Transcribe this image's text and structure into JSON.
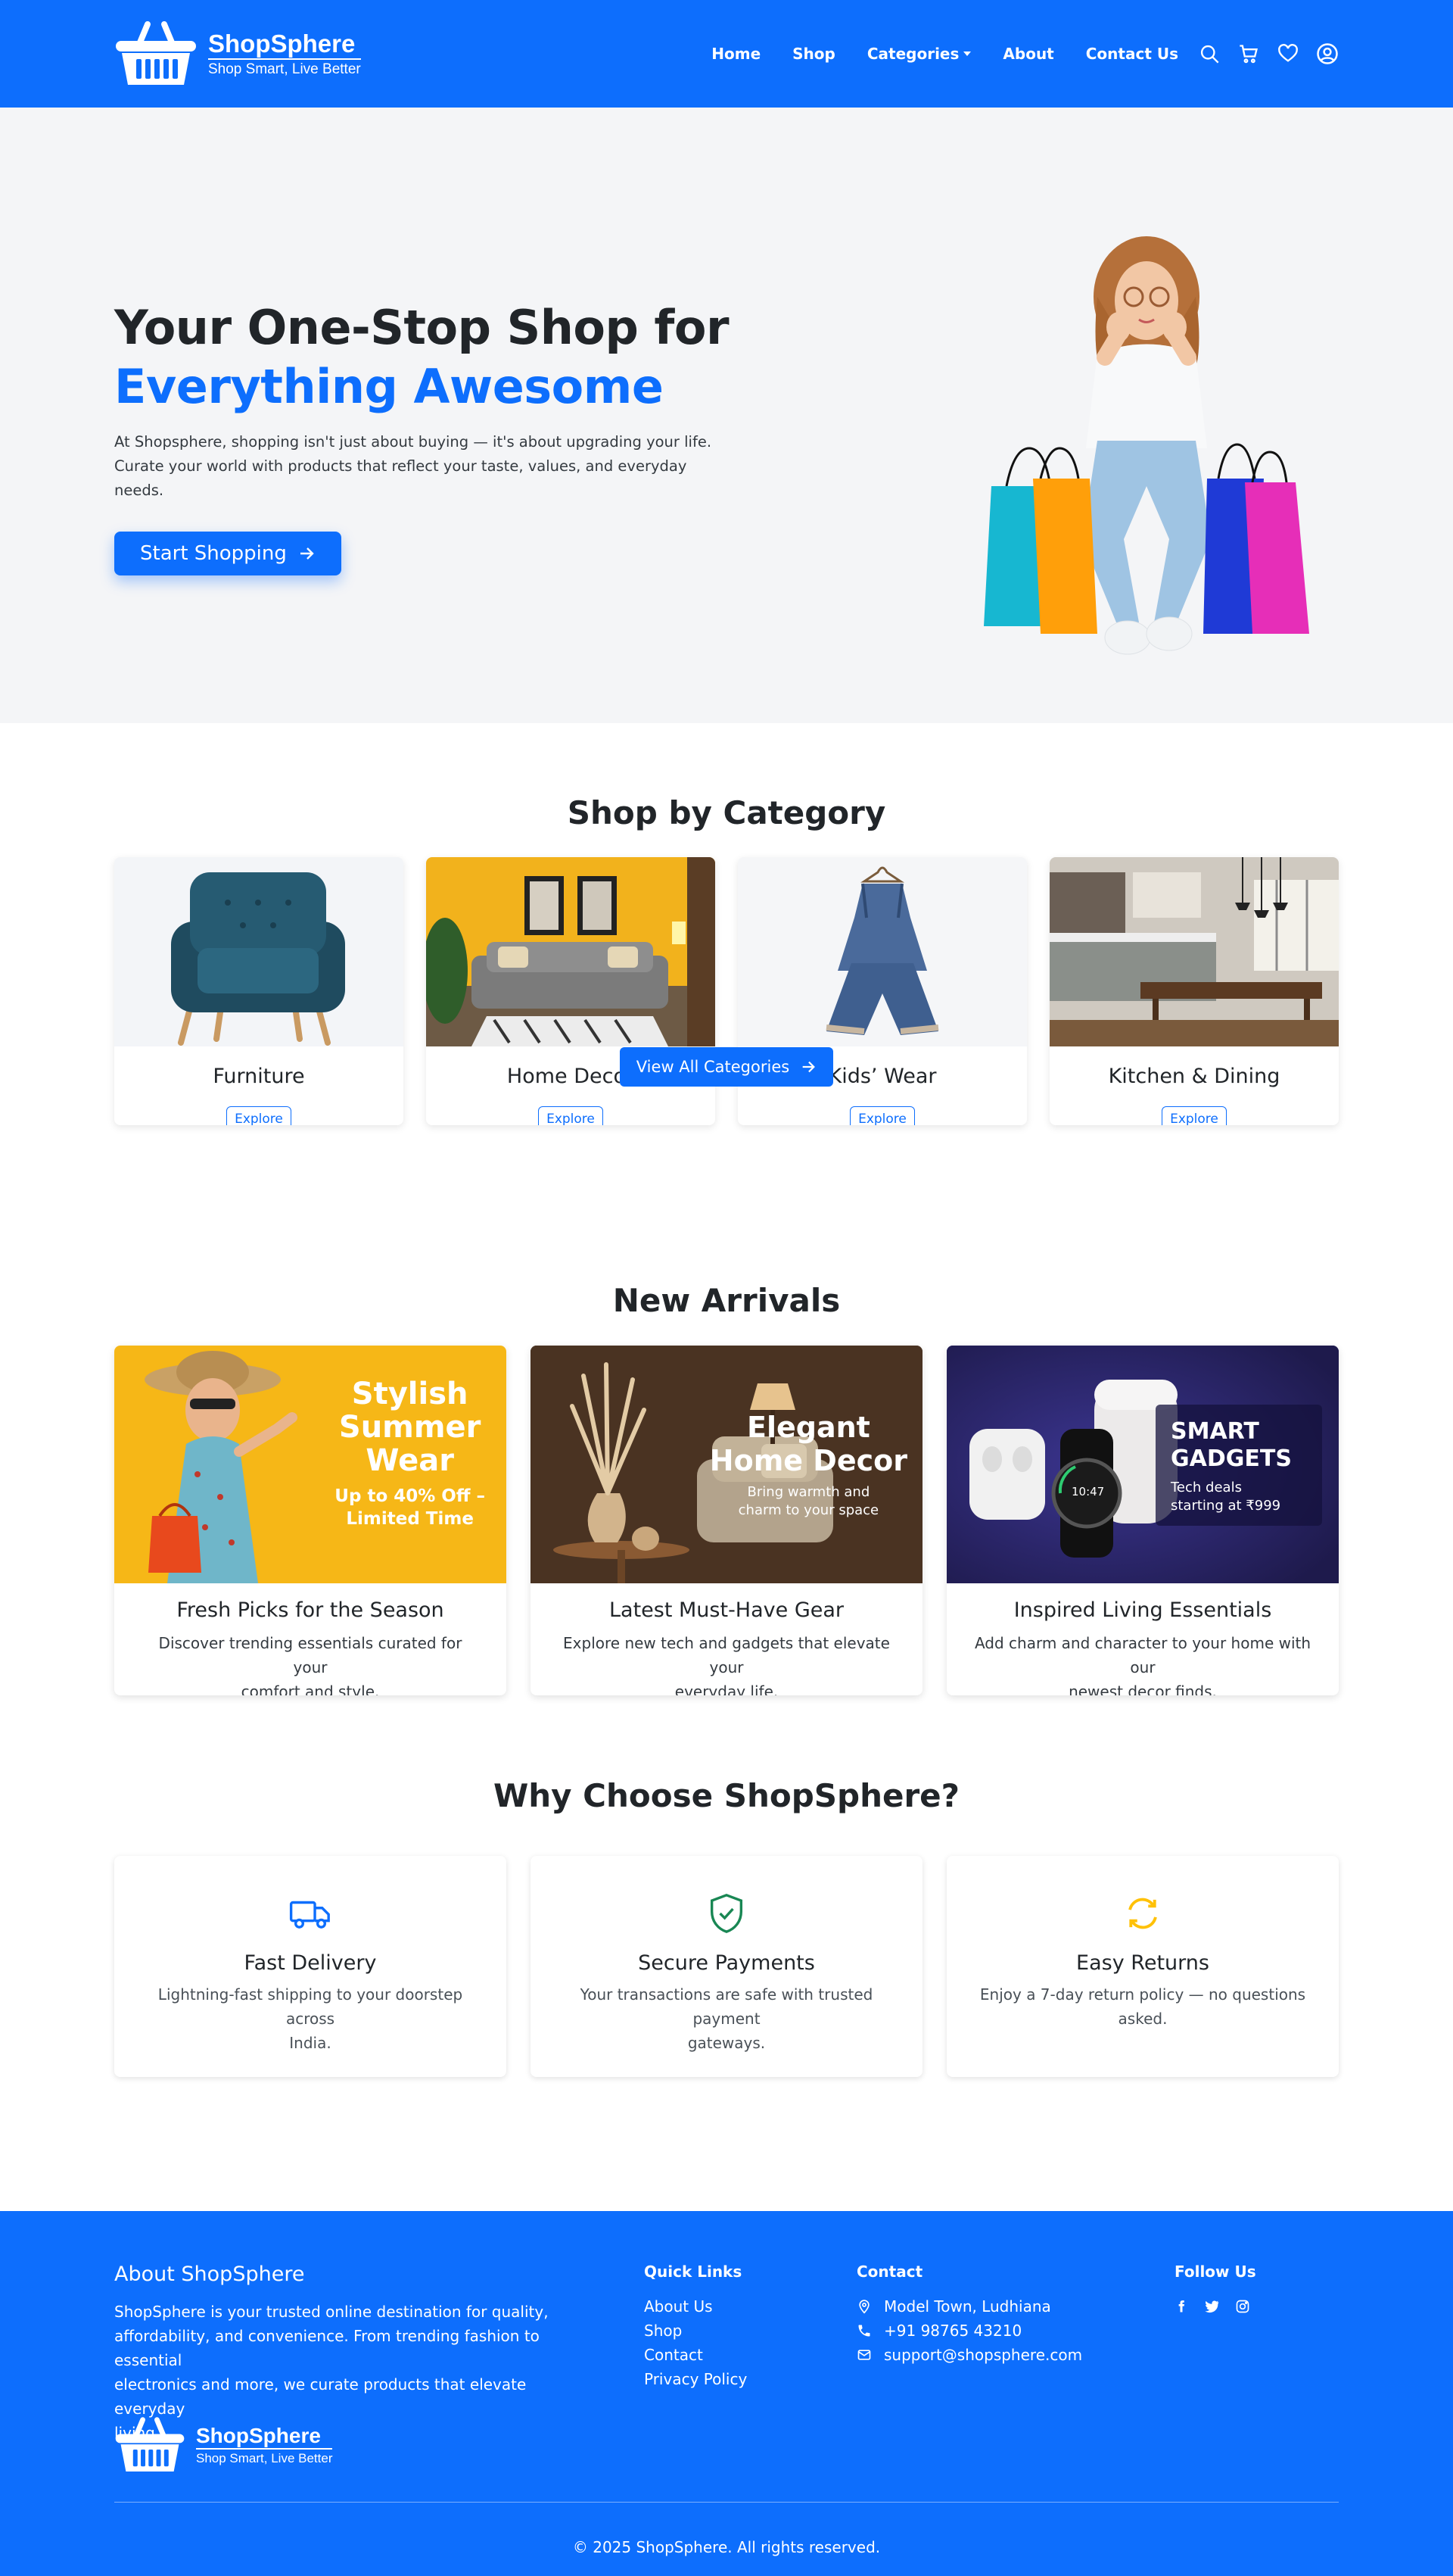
{
  "nav": {
    "brand_name": "ShopSphere",
    "brand_tagline": "Shop Smart, Live Better",
    "links": [
      "Home",
      "Shop",
      "Categories",
      "About",
      "Contact Us"
    ]
  },
  "hero": {
    "title_line1": "Your One-Stop Shop for",
    "title_line2": "Everything Awesome",
    "description_line1": "At Shopsphere, shopping isn't just about buying — it's about upgrading your life.",
    "description_line2": "Curate your world with products that reflect your taste, values, and everyday needs.",
    "cta_label": "Start Shopping"
  },
  "categories": {
    "title": "Shop by Category",
    "items": [
      {
        "name": "Furniture",
        "button": "Explore"
      },
      {
        "name": "Home Decor",
        "button": "Explore"
      },
      {
        "name": "Kids’ Wear",
        "button": "Explore"
      },
      {
        "name": "Kitchen & Dining",
        "button": "Explore"
      }
    ],
    "view_all_label": "View All Categories"
  },
  "arrivals": {
    "title": "New Arrivals",
    "items": [
      {
        "banner_title": "Stylish Summer Wear",
        "banner_line1": "Stylish",
        "banner_line2": "Summer",
        "banner_line3": "Wear",
        "banner_sub1": "Up to 40% Off –",
        "banner_sub2": "Limited Time",
        "title": "Fresh Picks for the Season",
        "desc_line1": "Discover trending essentials curated for your",
        "desc_line2": "comfort and style."
      },
      {
        "banner_line1": "Elegant",
        "banner_line2": "Home Decor",
        "banner_sub1": "Bring warmth and",
        "banner_sub2": "charm to your space",
        "title": "Latest Must-Have Gear",
        "desc_line1": "Explore new tech and gadgets that elevate your",
        "desc_line2": "everyday life."
      },
      {
        "banner_line1": "SMART",
        "banner_line2": "GADGETS",
        "banner_sub1": "Tech deals",
        "banner_sub2": "starting at ₹999",
        "watch_time": "10:47",
        "title": "Inspired Living Essentials",
        "desc_line1": "Add charm and character to your home with our",
        "desc_line2": "newest decor finds."
      }
    ]
  },
  "why": {
    "title": "Why Choose ShopSphere?",
    "items": [
      {
        "title": "Fast Delivery",
        "desc_line1": "Lightning-fast shipping to your doorstep across",
        "desc_line2": "India.",
        "icon": "truck-icon",
        "color": "#0d6efd"
      },
      {
        "title": "Secure Payments",
        "desc_line1": "Your transactions are safe with trusted payment",
        "desc_line2": "gateways.",
        "icon": "shield-check-icon",
        "color": "#198754"
      },
      {
        "title": "Easy Returns",
        "desc_line1": "Enjoy a 7-day return policy — no questions",
        "desc_line2": "asked.",
        "icon": "arrow-repeat-icon",
        "color": "#ffc107"
      }
    ]
  },
  "footer": {
    "about_title": "About ShopSphere",
    "about_line1": "ShopSphere is your trusted online destination for quality,",
    "about_line2": "affordability, and convenience. From trending fashion to essential",
    "about_line3": "electronics and more, we curate products that elevate everyday",
    "about_line4": "living.",
    "quick_links_title": "Quick Links",
    "quick_links": [
      "About Us",
      "Shop",
      "Contact",
      "Privacy Policy"
    ],
    "contact_title": "Contact",
    "address": "Model Town, Ludhiana",
    "phone": "+91 98765 43210",
    "email": "support@shopsphere.com",
    "follow_title": "Follow Us",
    "copyright": "© 2025 ShopSphere. All rights reserved."
  },
  "colors": {
    "primary": "#0d6efd",
    "hero_bg": "#f4f5f7"
  }
}
